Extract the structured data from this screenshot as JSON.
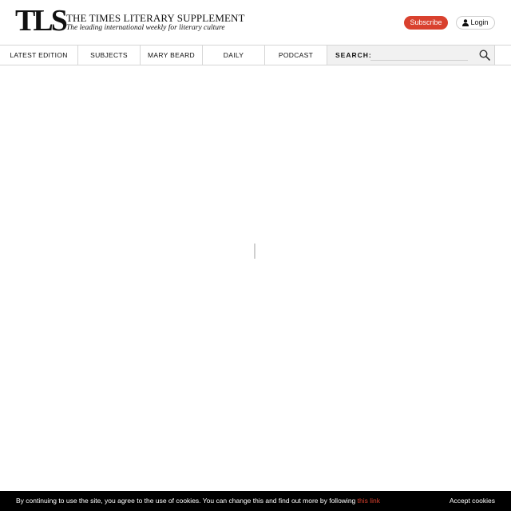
{
  "brand": {
    "logo": "TLS",
    "title": "THE TIMES LITERARY SUPPLEMENT",
    "tagline": "The leading international weekly for literary culture"
  },
  "header": {
    "subscribe_label": "Subscribe",
    "login_label": "Login",
    "accent_color": "#d9412e"
  },
  "nav": {
    "items": [
      {
        "label": "LATEST EDITION"
      },
      {
        "label": "SUBJECTS"
      },
      {
        "label": "MARY BEARD"
      },
      {
        "label": "DAILY"
      },
      {
        "label": "PODCAST"
      }
    ],
    "search_label": "SEARCH:",
    "search_value": "",
    "search_icon": "magnifier-icon"
  },
  "cookie": {
    "text": "By continuing to use the site, you agree to the use of cookies. You can change this and find out more by following ",
    "link_label": "this link",
    "accept_label": "Accept cookies"
  }
}
